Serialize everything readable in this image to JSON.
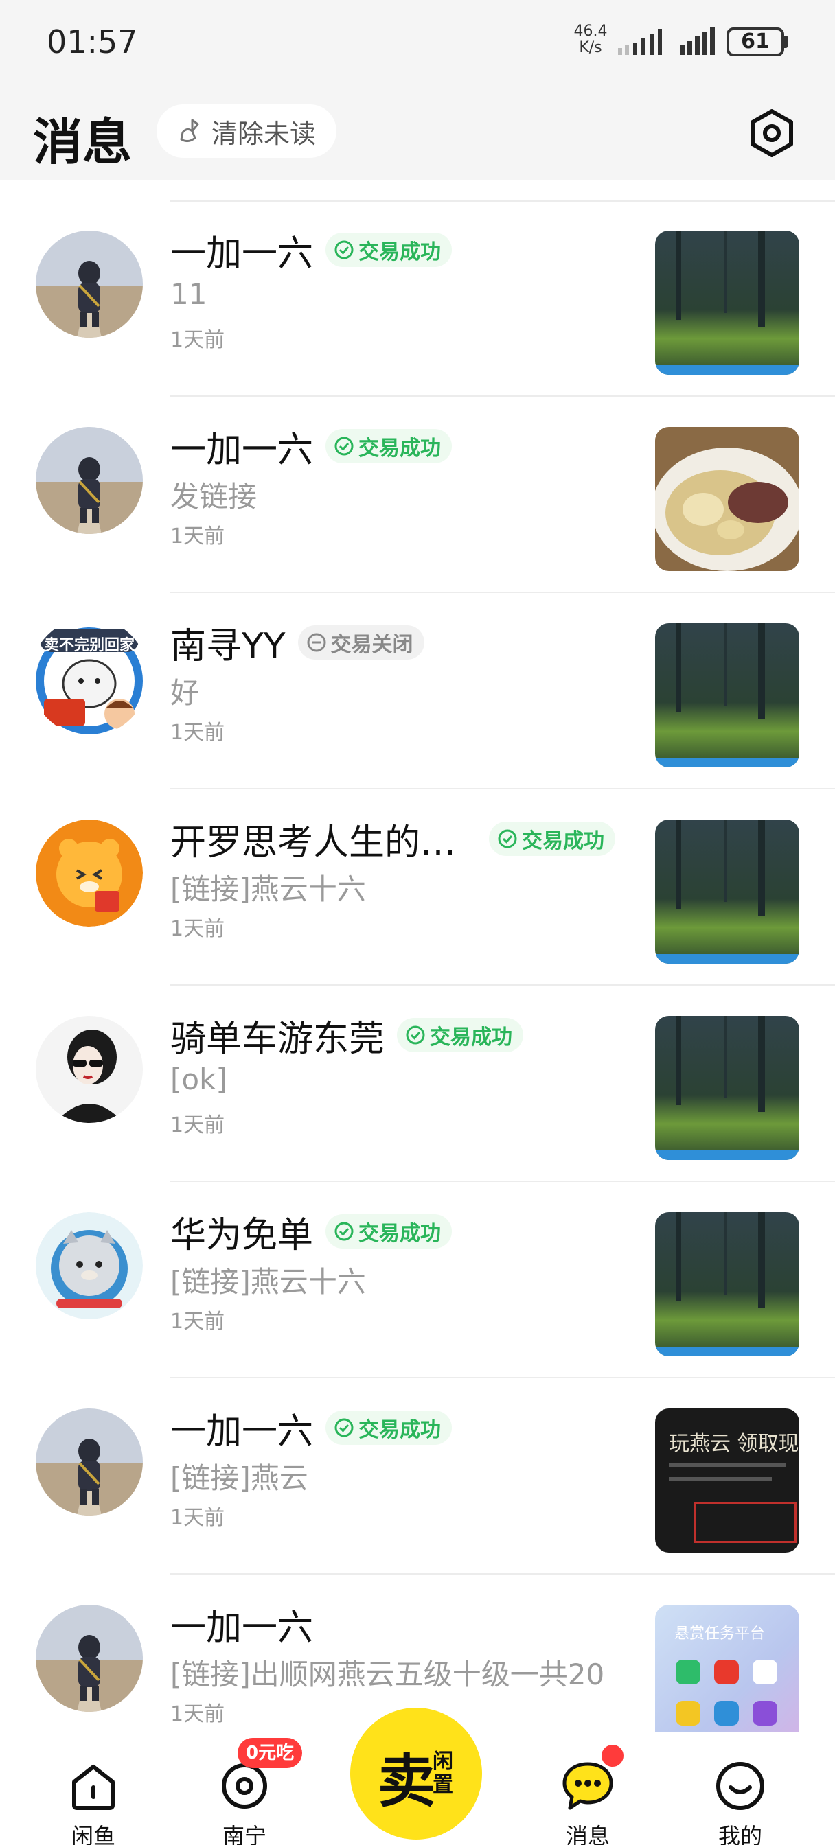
{
  "status_bar": {
    "time": "01:57",
    "net_speed_value": "46.4",
    "net_speed_unit": "K/s",
    "battery": "61"
  },
  "header": {
    "title": "消息",
    "clear_unread": "清除未读"
  },
  "conversations": [
    {
      "name": "一加一六",
      "status": "交易成功",
      "status_type": "success",
      "preview": "11",
      "time": "1天前",
      "avatar": "child-on-road",
      "thumb": "forest"
    },
    {
      "name": "一加一六",
      "status": "交易成功",
      "status_type": "success",
      "preview": "发链接",
      "time": "1天前",
      "avatar": "child-on-road",
      "thumb": "food-plate"
    },
    {
      "name": "南寻YY",
      "status": "交易关闭",
      "status_type": "closed",
      "preview": "好",
      "time": "1天前",
      "avatar": "cartoon-bear",
      "avatar_text": "卖不完别回家",
      "thumb": "forest"
    },
    {
      "name": "开罗思考人生的…",
      "status": "交易成功",
      "status_type": "success",
      "preview": "[链接]燕云十六",
      "time": "1天前",
      "avatar": "orange-tiger",
      "thumb": "forest"
    },
    {
      "name": "骑单车游东莞",
      "status": "交易成功",
      "status_type": "success",
      "preview": "[ok]",
      "time": "1天前",
      "avatar": "woman-sunglasses",
      "thumb": "forest"
    },
    {
      "name": "华为免单",
      "status": "交易成功",
      "status_type": "success",
      "preview": "[链接]燕云十六",
      "time": "1天前",
      "avatar": "cat-astronaut",
      "thumb": "forest"
    },
    {
      "name": "一加一六",
      "status": "交易成功",
      "status_type": "success",
      "preview": "[链接]燕云",
      "time": "1天前",
      "avatar": "child-on-road",
      "thumb": "game-promo",
      "thumb_text": "玩燕云 领取现"
    },
    {
      "name": "一加一六",
      "status": "",
      "status_type": "none",
      "preview": "[链接]出顺网燕云五级十级一共20",
      "time": "1天前",
      "avatar": "child-on-road",
      "thumb": "phone-screen",
      "thumb_text": "悬赏任务平台"
    }
  ],
  "bottom_nav": {
    "home": "闲鱼",
    "local": "南宁",
    "local_badge": "0元吃",
    "sell_main": "卖",
    "sell_sub": "闲置",
    "messages": "消息",
    "mine": "我的"
  },
  "colors": {
    "accent_yellow": "#ffe21a",
    "success_green": "#2ab55a",
    "badge_red": "#ff3b3b"
  }
}
